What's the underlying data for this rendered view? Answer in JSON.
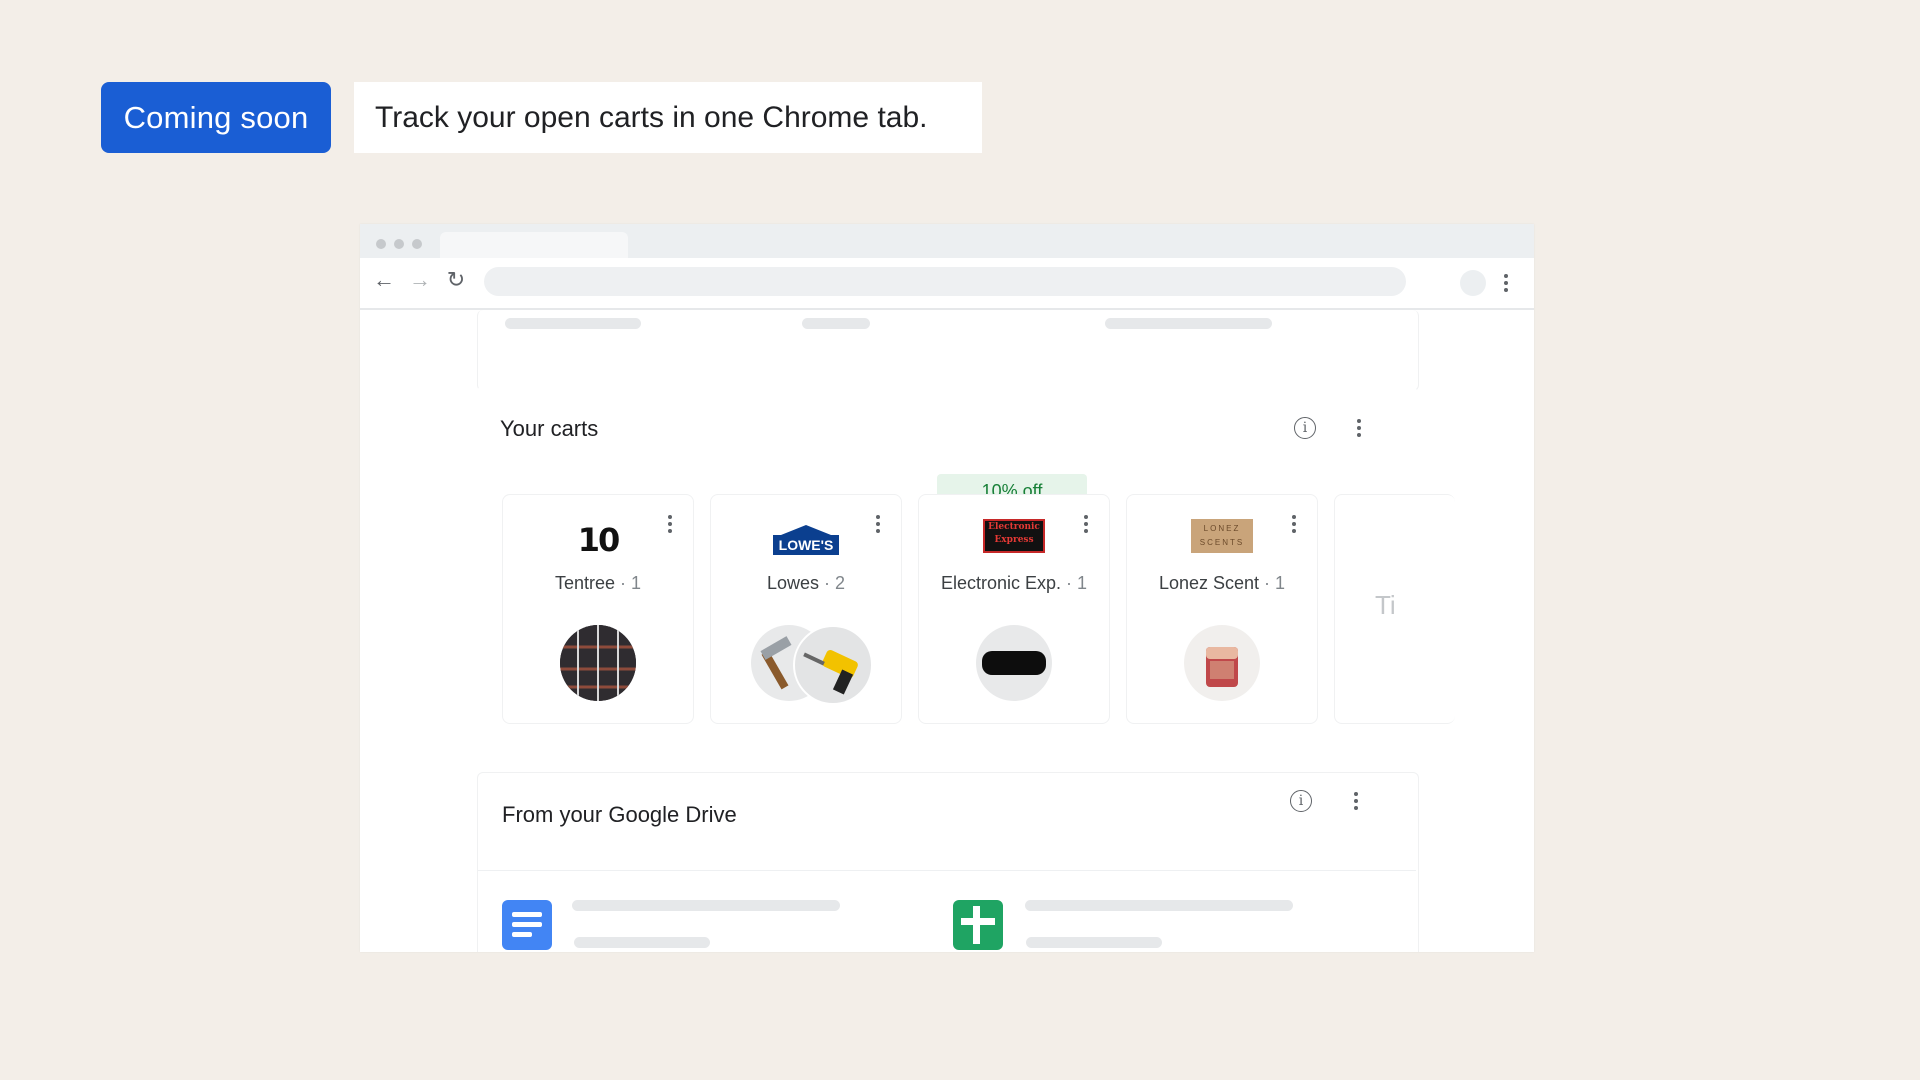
{
  "badge": {
    "label": "Coming soon"
  },
  "caption": {
    "text": "Track your open carts in one Chrome tab."
  },
  "carts_module": {
    "title": "Your carts",
    "carts": [
      {
        "merchant": "Tentree",
        "sep": "·",
        "count": "1",
        "logo_text": "10",
        "product_icon": "flannel-shirt-icon"
      },
      {
        "merchant": "Lowes",
        "sep": "·",
        "count": "2",
        "logo_text": "LOWE'S",
        "product_icon": "hammer-drill-icon"
      },
      {
        "merchant": "Electronic Exp.",
        "sep": "·",
        "count": "1",
        "logo_text": "Electronic Express",
        "product_icon": "soundbar-icon",
        "discount": "10% off"
      },
      {
        "merchant": "Lonez Scent",
        "sep": "·",
        "count": "1",
        "logo_text": "LONEZ SCENTS",
        "product_icon": "candle-icon"
      }
    ],
    "peek_text": "Ti"
  },
  "drive_module": {
    "title": "From your Google Drive"
  },
  "colors": {
    "accent": "#1a5ed4",
    "discount_bg": "#e6f4ea",
    "discount_text": "#188038",
    "docs_blue": "#4285f4",
    "sheets_green": "#0f9d58"
  }
}
